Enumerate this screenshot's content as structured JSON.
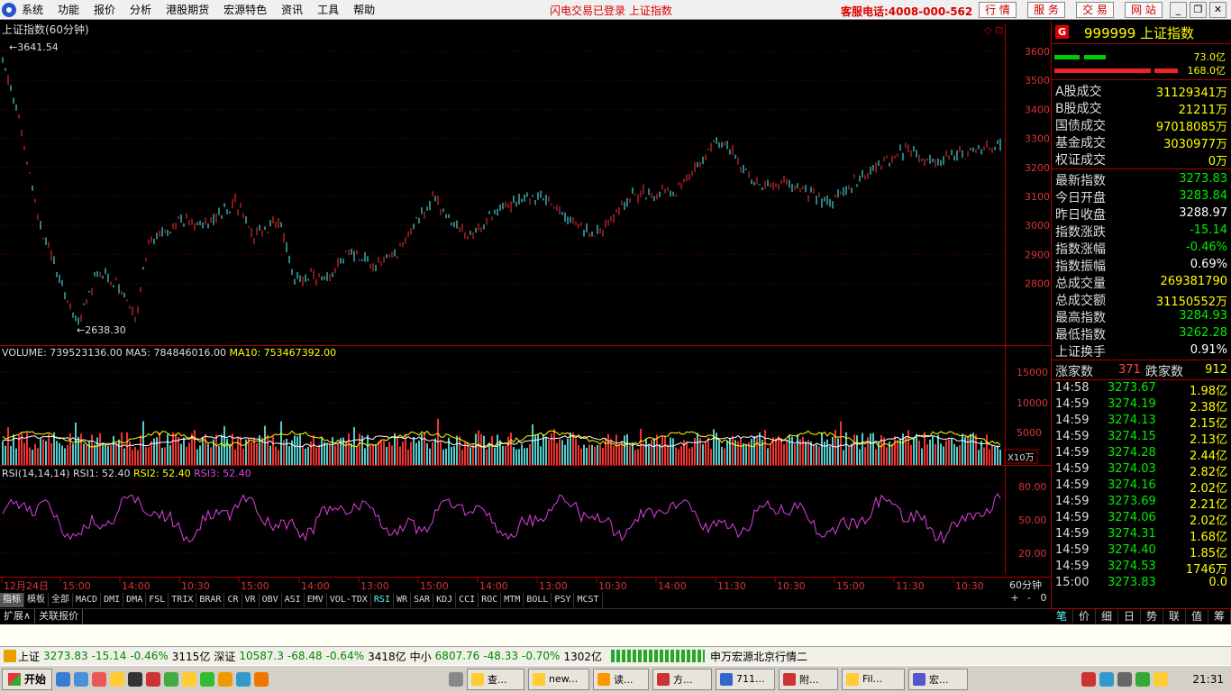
{
  "menu": {
    "items": [
      "系统",
      "功能",
      "报价",
      "分析",
      "港股期货",
      "宏源特色",
      "资讯",
      "工具",
      "帮助"
    ],
    "login_status": "闪电交易已登录  上证指数",
    "hotline": "客服电话:4008-000-562",
    "tabs": [
      "行 情",
      "服 务",
      "交 易",
      "网 站"
    ]
  },
  "chart": {
    "title": "上证指数(60分钟)",
    "high_label": "3641.54",
    "low_label": "2638.30",
    "price_ticks": [
      "3600",
      "3500",
      "3400",
      "3300",
      "3200",
      "3100",
      "3000",
      "2900",
      "2800"
    ],
    "volume_header": {
      "vol": "VOLUME: 739523136.00",
      "ma5": "MA5: 784846016.00",
      "ma10": "MA10: 753467392.00"
    },
    "volume_ticks": [
      "15000",
      "10000",
      "5000"
    ],
    "volume_unit": "X10万",
    "rsi_header": {
      "params": "RSI(14,14,14)",
      "rsi1": "RSI1: 52.40",
      "rsi2": "RSI2: 52.40",
      "rsi3": "RSI3: 52.40"
    },
    "rsi_ticks": [
      "80.00",
      "50.00",
      "20.00"
    ],
    "time_labels": [
      "12月24日",
      "15:00",
      "14:00",
      "10:30",
      "15:00",
      "14:00",
      "13:00",
      "15:00",
      "14:00",
      "13:00",
      "10:30",
      "14:00",
      "11:30",
      "10:30",
      "15:00",
      "11:30",
      "10:30"
    ],
    "period": "60分钟",
    "zoom": [
      "+",
      "-",
      "0"
    ]
  },
  "indicators": [
    "指标",
    "模板",
    "全部",
    "MACD",
    "DMI",
    "DMA",
    "FSL",
    "TRIX",
    "BRAR",
    "CR",
    "VR",
    "OBV",
    "ASI",
    "EMV",
    "VOL-TDX",
    "RSI",
    "WR",
    "SAR",
    "KDJ",
    "CCI",
    "ROC",
    "MTM",
    "BOLL",
    "PSY",
    "MCST"
  ],
  "ext_tabs": [
    "扩展∧",
    "关联报价"
  ],
  "side": {
    "badge": "G",
    "code": "999999",
    "name": "上证指数",
    "bar1": "73.0亿",
    "bar2": "168.0亿",
    "turnover": [
      [
        "A股成交",
        "31129341万"
      ],
      [
        "B股成交",
        "21211万"
      ],
      [
        "国债成交",
        "97018085万"
      ],
      [
        "基金成交",
        "3030977万"
      ],
      [
        "权证成交",
        "0万"
      ]
    ],
    "stats": [
      [
        "最新指数",
        "3273.83"
      ],
      [
        "今日开盘",
        "3283.84"
      ],
      [
        "昨日收盘",
        "3288.97"
      ],
      [
        "指数涨跌",
        "-15.14"
      ],
      [
        "指数涨幅",
        "-0.46%"
      ],
      [
        "指数振幅",
        "0.69%"
      ],
      [
        "总成交量",
        "269381790"
      ],
      [
        "总成交额",
        "31150552万"
      ],
      [
        "最高指数",
        "3284.93"
      ],
      [
        "最低指数",
        "3262.28"
      ],
      [
        "上证换手",
        "0.91%"
      ]
    ],
    "rise_label": "涨家数",
    "rise": "371",
    "fall_label": "跌家数",
    "fall": "912",
    "ticks": [
      [
        "14:58",
        "3273.67",
        "1.98亿"
      ],
      [
        "14:59",
        "3274.19",
        "2.38亿"
      ],
      [
        "14:59",
        "3274.13",
        "2.15亿"
      ],
      [
        "14:59",
        "3274.15",
        "2.13亿"
      ],
      [
        "14:59",
        "3274.28",
        "2.44亿"
      ],
      [
        "14:59",
        "3274.03",
        "2.82亿"
      ],
      [
        "14:59",
        "3274.16",
        "2.02亿"
      ],
      [
        "14:59",
        "3273.69",
        "2.21亿"
      ],
      [
        "14:59",
        "3274.06",
        "2.02亿"
      ],
      [
        "14:59",
        "3274.31",
        "1.68亿"
      ],
      [
        "14:59",
        "3274.40",
        "1.85亿"
      ],
      [
        "14:59",
        "3274.53",
        "1746万"
      ],
      [
        "15:00",
        "3273.83",
        "0.0"
      ]
    ],
    "tabs": [
      "笔",
      "价",
      "细",
      "日",
      "势",
      "联",
      "值",
      "筹"
    ]
  },
  "ticker": {
    "sh_label": "上证",
    "sh_val": "3273.83",
    "sh_chg": "-15.14",
    "sh_pct": "-0.46%",
    "sh_amt": "3115亿",
    "sz_label": "深证",
    "sz_val": "10587.3",
    "sz_chg": "-68.48",
    "sz_pct": "-0.64%",
    "sz_amt": "3418亿",
    "zx_label": "中小",
    "zx_val": "6807.76",
    "zx_chg": "-48.33",
    "zx_pct": "-0.70%",
    "zx_amt": "1302亿",
    "broker": "申万宏源北京行情二"
  },
  "taskbar": {
    "start": "开始",
    "items": [
      "查...",
      "new...",
      "读...",
      "方...",
      "711...",
      "附...",
      "Fil...",
      "宏..."
    ],
    "clock": "21:31"
  }
}
